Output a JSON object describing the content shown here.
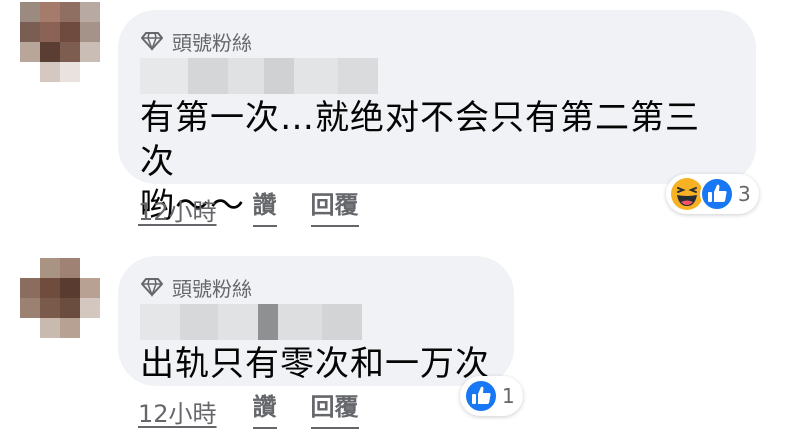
{
  "comments": [
    {
      "badge": "頭號粉絲",
      "text": "有第一次…就绝对不会只有第二第三次哟～～",
      "line1": "有第一次…就绝对不会只有第二第三次",
      "line2": "哟～～",
      "time": "12小時",
      "like": "讚",
      "reply": "回覆",
      "reaction_count": "3",
      "reactions": [
        "haha-icon",
        "like-icon"
      ]
    },
    {
      "badge": "頭號粉絲",
      "text": "出轨只有零次和一万次",
      "time": "12小時",
      "like": "讚",
      "reply": "回覆",
      "reaction_count": "1",
      "reactions": [
        "like-icon"
      ]
    }
  ],
  "colors": {
    "bubble": "#f0f2f5",
    "secondary_text": "#65676b",
    "like_blue": "#1877f2",
    "haha_yellow": "#f7b125"
  }
}
